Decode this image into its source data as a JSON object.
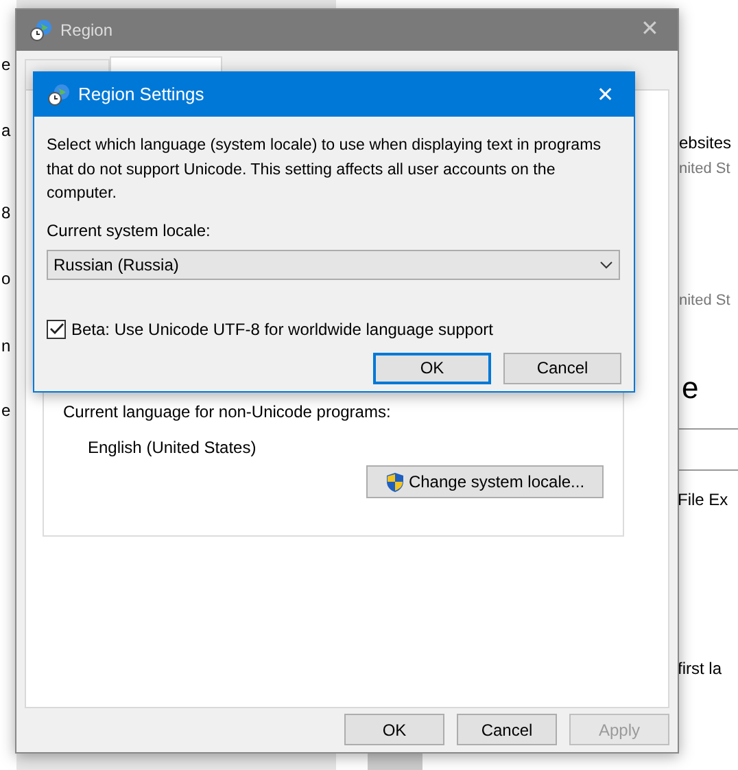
{
  "background": {
    "left_fragments": [
      "e",
      "a",
      "8",
      "o",
      "n",
      "e"
    ],
    "right_fragments": [
      "ebsites",
      "nited St",
      "nited St",
      "e",
      "File Ex",
      "first la"
    ]
  },
  "region_window": {
    "title": "Region",
    "close": "✕",
    "tabs": [
      {
        "selected": false
      },
      {
        "selected": true
      }
    ],
    "current_language_label": "Current language for non-Unicode programs:",
    "current_language": "English (United States)",
    "change_button": "Change system locale...",
    "buttons": [
      {
        "label": "OK",
        "disabled": false
      },
      {
        "label": "Cancel",
        "disabled": false
      },
      {
        "label": "Apply",
        "disabled": true
      }
    ]
  },
  "dialog": {
    "title": "Region Settings",
    "close": "✕",
    "description": "Select which language (system locale) to use when displaying text in programs that do not support Unicode. This setting affects all user accounts on the computer.",
    "locale_label": "Current system locale:",
    "locale_value": "Russian (Russia)",
    "utf8_checkbox": {
      "label": "Beta: Use Unicode UTF-8 for worldwide language support",
      "checked": true
    },
    "buttons": [
      {
        "label": "OK",
        "default": true
      },
      {
        "label": "Cancel",
        "default": false
      }
    ]
  }
}
